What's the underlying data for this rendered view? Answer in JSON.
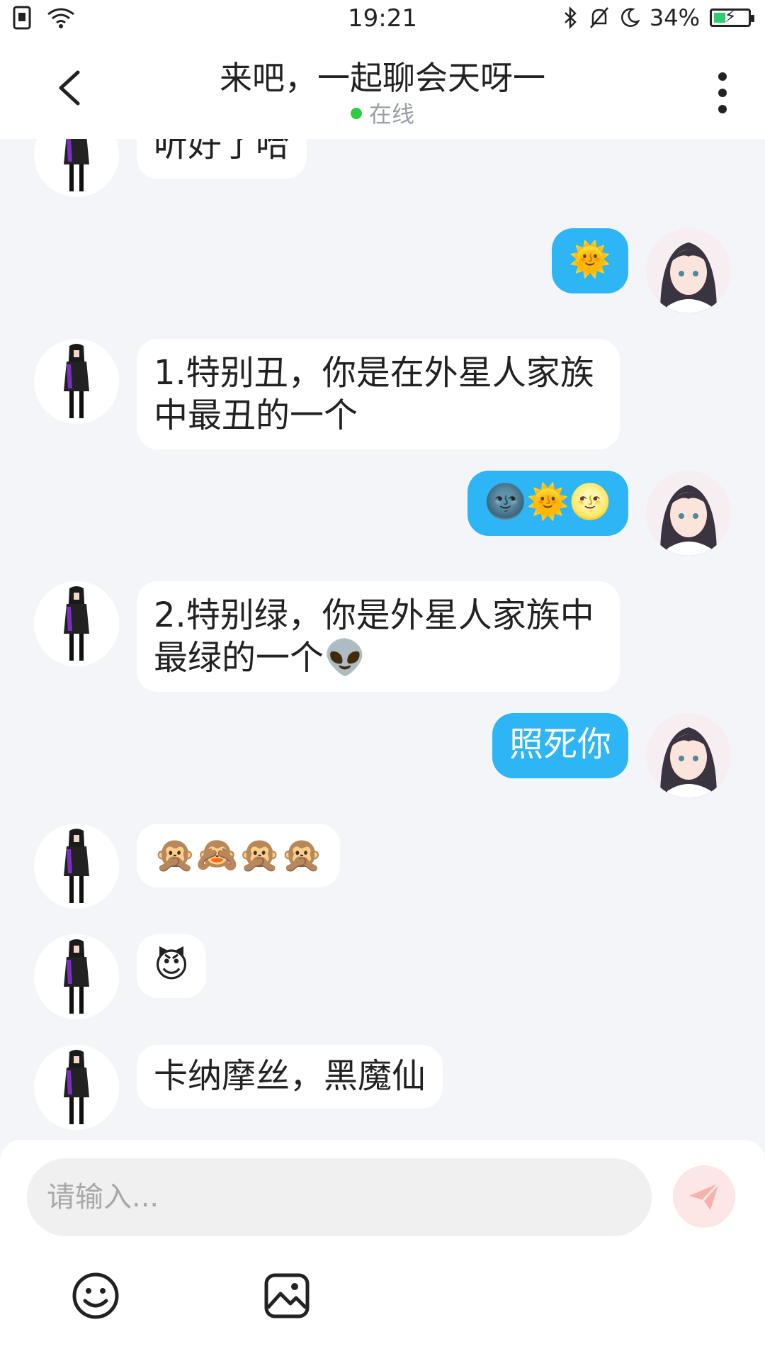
{
  "status_bar": {
    "time": "19:21",
    "battery_percent": "34%",
    "battery_level": 0.34,
    "icons_left": [
      "sim-icon",
      "wifi-icon"
    ],
    "icons_right": [
      "bluetooth-icon",
      "mute-bell-icon",
      "moon-icon",
      "battery-icon"
    ]
  },
  "header": {
    "title": "来吧，一起聊会天呀一",
    "status": "在线",
    "status_color": "#2ecc40"
  },
  "messages": [
    {
      "side": "left",
      "text": "听好了哈"
    },
    {
      "side": "right",
      "text": "🌞"
    },
    {
      "side": "left",
      "text": "1.特别丑，你是在外星人家族中最丑的一个"
    },
    {
      "side": "right",
      "text": "🌚🌞🌝"
    },
    {
      "side": "left",
      "text": "2.特别绿，你是外星人家族中最绿的一个👽"
    },
    {
      "side": "right",
      "text": "照死你"
    },
    {
      "side": "left",
      "text": "🙊🙈🙊🙊"
    },
    {
      "side": "left",
      "text": "😈"
    },
    {
      "side": "left",
      "text": "卡纳摩丝，黑魔仙"
    }
  ],
  "composer": {
    "placeholder": "请输入...",
    "send_icon": "paper-plane-icon",
    "tools": [
      "emoji-icon",
      "image-icon"
    ]
  },
  "colors": {
    "outgoing_bubble": "#2db5f5",
    "incoming_bubble": "#ffffff",
    "background": "#f3f5f8",
    "send_button": "#fde7e6"
  }
}
